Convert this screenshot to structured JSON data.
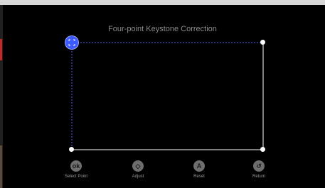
{
  "title": "Four-point Keystone Correction",
  "controls": [
    {
      "label": "Select Point",
      "icon_name": "ok-icon",
      "glyph": "ok"
    },
    {
      "label": "Adjust",
      "icon_name": "directional-pad-icon",
      "glyph": "◇"
    },
    {
      "label": "Reset",
      "icon_name": "reset-icon",
      "glyph": "A"
    },
    {
      "label": "Return",
      "icon_name": "return-icon",
      "glyph": "↺"
    }
  ],
  "colors": {
    "background": "#000000",
    "selected_point": "#3d5afe",
    "selected_edges": "#4a5ff0",
    "frame_edges": "#ffffff"
  }
}
